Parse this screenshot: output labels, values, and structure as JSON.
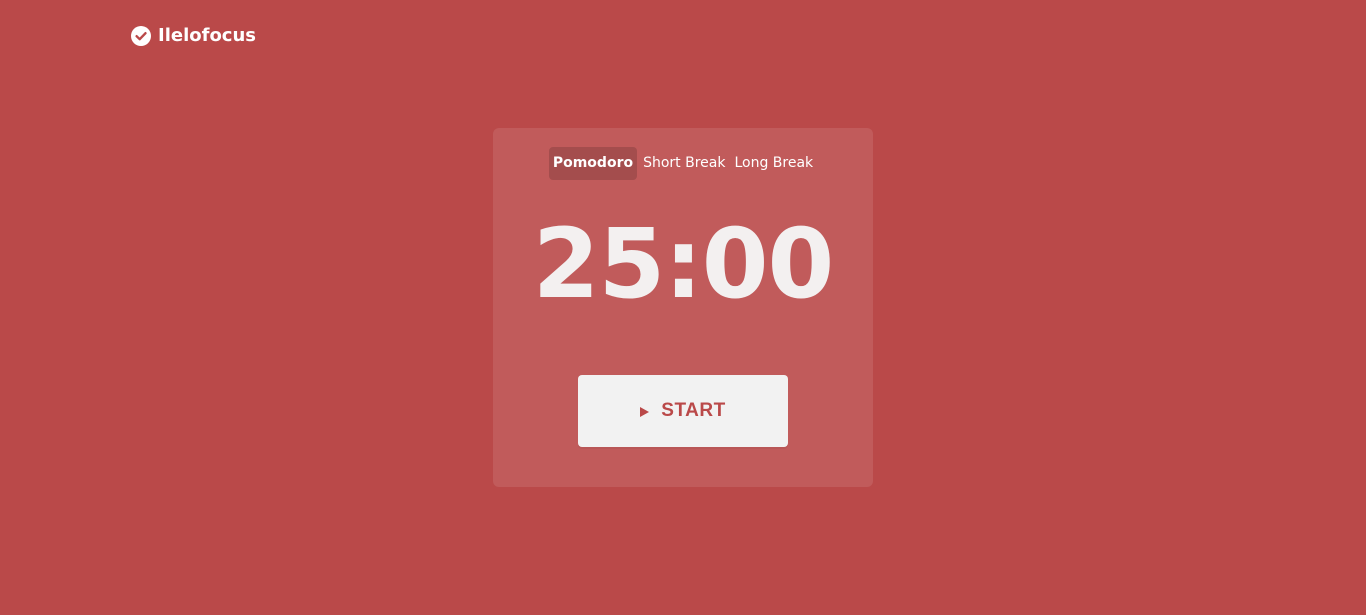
{
  "app": {
    "name": "Ilelofocus",
    "logo_icon": "check-circle-icon",
    "background_color": "#ba4949",
    "accent_color": "#ba4949"
  },
  "timer": {
    "tabs": [
      {
        "label": "Pomodoro",
        "active": true
      },
      {
        "label": "Short Break",
        "active": false
      },
      {
        "label": "Long Break",
        "active": false
      }
    ],
    "display": "25:00",
    "start_button": {
      "label": "START",
      "icon": "play-icon"
    }
  }
}
